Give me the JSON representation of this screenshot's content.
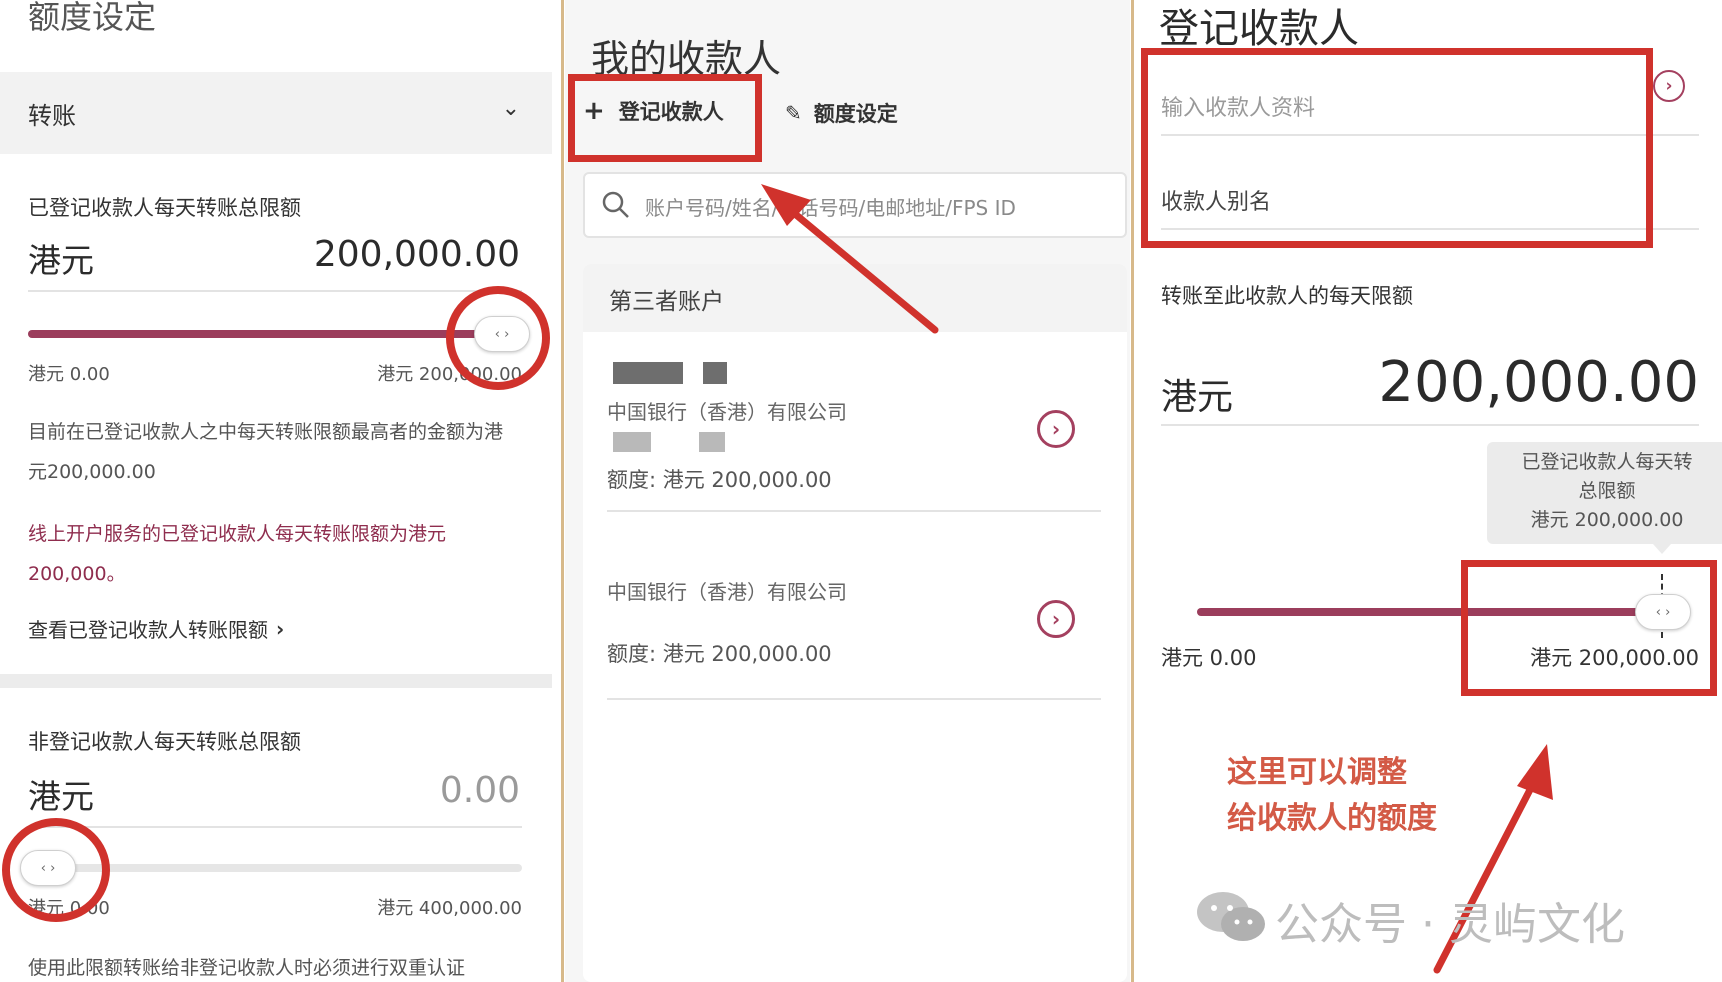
{
  "panel1": {
    "title": "额度设定",
    "dropdown": {
      "label": "转账",
      "chevron": "chevron-down-icon"
    },
    "registered": {
      "label": "已登记收款人每天转账总限额",
      "currency": "港元",
      "amount": "200,000.00",
      "slider_min": "港元 0.00",
      "slider_max": "港元 200,000.00",
      "slider_fraction": 1.0,
      "knob_glyph": "‹ ›",
      "note": "目前在已登记收款人之中每天转账限额最高者的金额为港元200,000.00",
      "red_note": "线上开户服务的已登记收款人每天转账限额为港元200,000。",
      "link": "查看已登记收款人转账限额",
      "link_icon": "chevron-right-icon"
    },
    "unregistered": {
      "label": "非登记收款人每天转账总限额",
      "currency": "港元",
      "amount": "0.00",
      "slider_min": "港元 0.00",
      "slider_max": "港元 400,000.00",
      "slider_fraction": 0.0,
      "knob_glyph": "‹ ›",
      "note": "使用此限额转账给非登记收款人时必须进行双重认证"
    }
  },
  "panel2": {
    "title": "我的收款人",
    "tab_add": {
      "icon": "plus-icon",
      "label": "登记收款人"
    },
    "tab_limit": {
      "icon": "edit-icon",
      "label": "额度设定"
    },
    "search": {
      "icon": "search-icon",
      "placeholder": "账户号码/姓名/电话号码/电邮地址/FPS ID"
    },
    "section": "第三者账户",
    "payees": [
      {
        "bank": "中国银行（香港）有限公司",
        "quota": "额度: 港元 200,000.00",
        "icon": "chevron-circle-icon"
      },
      {
        "bank": "中国银行（香港）有限公司",
        "quota": "额度: 港元 200,000.00",
        "icon": "chevron-circle-icon"
      }
    ]
  },
  "panel3": {
    "title": "登记收款人",
    "input_placeholder": "输入收款人资料",
    "alias_label": "收款人别名",
    "limit_label": "转账至此收款人的每天限额",
    "currency": "港元",
    "amount": "200,000.00",
    "tooltip_line1": "已登记收款人每天转",
    "tooltip_line2": "总限额",
    "tooltip_line3": "港元 200,000.00",
    "slider_min": "港元 0.00",
    "slider_max": "港元 200,000.00",
    "slider_fraction": 1.0,
    "knob_glyph": "‹ ›",
    "annotation_line1": "这里可以调整",
    "annotation_line2": "给收款人的额度",
    "watermark": "公众号 · 灵屿文化"
  },
  "colors": {
    "accent": "#9b3d5c",
    "highlight": "#d0322c",
    "annotation": "#d35a46"
  }
}
